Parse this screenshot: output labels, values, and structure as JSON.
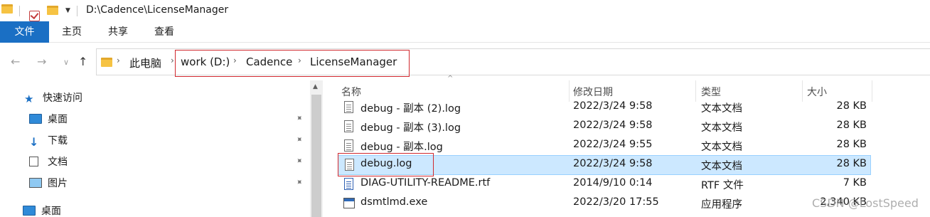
{
  "window": {
    "title": "D:\\Cadence\\LicenseManager"
  },
  "ribbon": {
    "tabs": [
      {
        "label": "文件"
      },
      {
        "label": "主页"
      },
      {
        "label": "共享"
      },
      {
        "label": "查看"
      }
    ]
  },
  "address_bar": {
    "crumbs": [
      {
        "label": "此电脑"
      },
      {
        "label": "work (D:)"
      },
      {
        "label": "Cadence"
      },
      {
        "label": "LicenseManager"
      }
    ]
  },
  "nav_pane": {
    "items": [
      {
        "label": "快速访问",
        "icon": "star-icon"
      },
      {
        "label": "桌面",
        "icon": "desktop-icon",
        "pinned": true
      },
      {
        "label": "下载",
        "icon": "download-icon",
        "pinned": true
      },
      {
        "label": "文档",
        "icon": "documents-icon",
        "pinned": true
      },
      {
        "label": "图片",
        "icon": "pictures-icon",
        "pinned": true
      },
      {
        "label": "桌面",
        "icon": "desktop-icon"
      }
    ]
  },
  "file_list": {
    "columns": {
      "name": "名称",
      "modified": "修改日期",
      "type": "类型",
      "size": "大小"
    },
    "rows": [
      {
        "name": "debug - 副本 (2).log",
        "modified": "2022/3/24 9:58",
        "type": "文本文档",
        "size": "28 KB",
        "icon": "text-file-icon"
      },
      {
        "name": "debug - 副本 (3).log",
        "modified": "2022/3/24 9:58",
        "type": "文本文档",
        "size": "28 KB",
        "icon": "text-file-icon"
      },
      {
        "name": "debug - 副本.log",
        "modified": "2022/3/24 9:55",
        "type": "文本文档",
        "size": "28 KB",
        "icon": "text-file-icon"
      },
      {
        "name": "debug.log",
        "modified": "2022/3/24 9:58",
        "type": "文本文档",
        "size": "28 KB",
        "icon": "text-file-icon",
        "selected": true
      },
      {
        "name": "DIAG-UTILITY-README.rtf",
        "modified": "2014/9/10 0:14",
        "type": "RTF 文件",
        "size": "7 KB",
        "icon": "rtf-file-icon"
      },
      {
        "name": "dsmtlmd.exe",
        "modified": "2022/3/20 17:55",
        "type": "应用程序",
        "size": "2,340 KB",
        "icon": "exe-file-icon"
      }
    ]
  },
  "watermark": "CSDN @LostSpeed",
  "colors": {
    "accent": "#1a6fc4",
    "selection": "#cce8ff",
    "highlight_box": "#d0282e"
  }
}
